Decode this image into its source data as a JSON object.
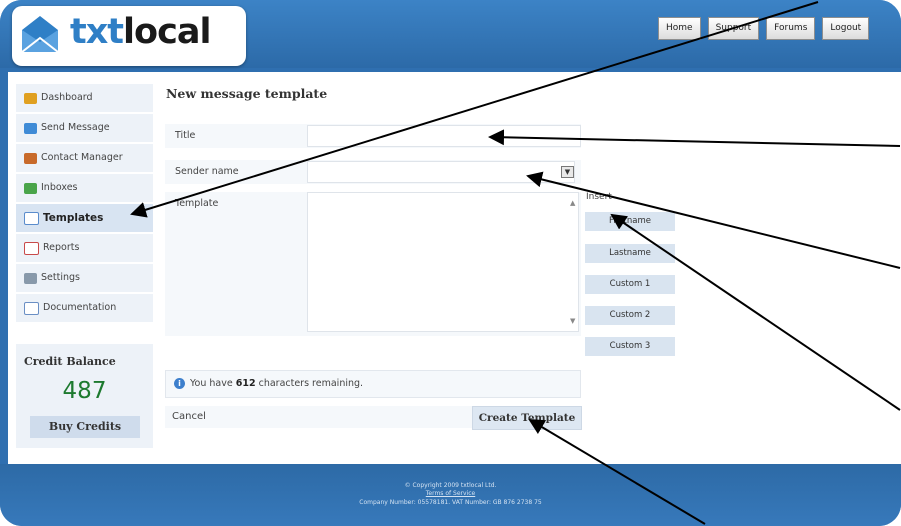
{
  "header": {
    "logo_prefix": "txt",
    "logo_suffix": "local",
    "nav": [
      "Home",
      "Support",
      "Forums",
      "Logout"
    ]
  },
  "sidebar": {
    "items": [
      {
        "label": "Dashboard",
        "icon": "house-icon",
        "color": "#e0a020"
      },
      {
        "label": "Send Message",
        "icon": "send-icon",
        "color": "#3f8bd6"
      },
      {
        "label": "Contact Manager",
        "icon": "contacts-icon",
        "color": "#c86a2a"
      },
      {
        "label": "Inboxes",
        "icon": "inbox-icon",
        "color": "#4aa54a"
      },
      {
        "label": "Templates",
        "icon": "templates-icon",
        "color": "#5a8ccc"
      },
      {
        "label": "Reports",
        "icon": "reports-icon",
        "color": "#c84a4a"
      },
      {
        "label": "Settings",
        "icon": "wrench-icon",
        "color": "#8899aa"
      },
      {
        "label": "Documentation",
        "icon": "document-icon",
        "color": "#6a8fc4"
      }
    ],
    "active": "Templates",
    "credit": {
      "title": "Credit Balance",
      "value": "487",
      "buy": "Buy Credits"
    }
  },
  "main": {
    "title": "New message template",
    "fields": {
      "title_label": "Title",
      "sender_label": "Sender name",
      "template_label": "Template"
    },
    "insert_label": "Insert",
    "insert_buttons": [
      "Firstname",
      "Lastname",
      "Custom 1",
      "Custom 2",
      "Custom 3"
    ],
    "info": {
      "prefix": "You have ",
      "count": "612",
      "suffix": " characters remaining."
    },
    "cancel": "Cancel",
    "create": "Create Template"
  },
  "footer": {
    "copyright": "© Copyright 2009 txtlocal Ltd.",
    "terms": "Terms of Service",
    "company": "Company Number: 05578181. VAT Number: GB 876 2738 75"
  },
  "colors": {
    "brand_blue": "#2f6fb0",
    "credit_green": "#1d7a2f"
  }
}
